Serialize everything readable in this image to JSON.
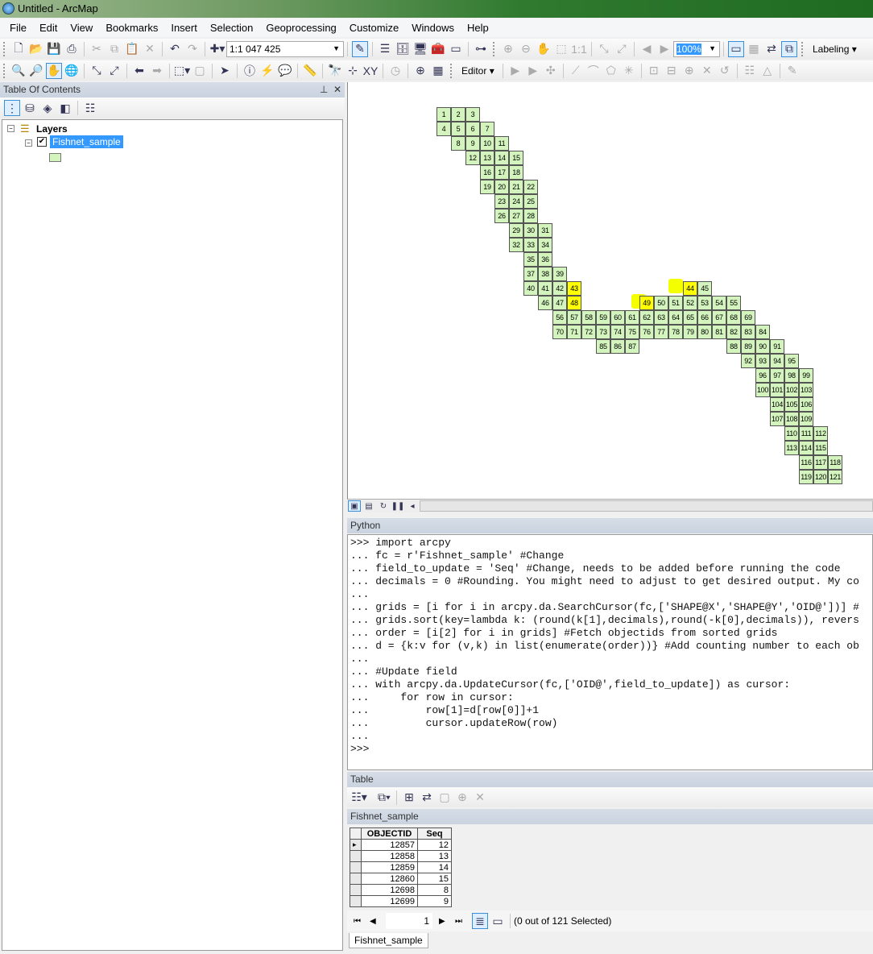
{
  "window": {
    "title": "Untitled - ArcMap"
  },
  "menu": [
    "File",
    "Edit",
    "View",
    "Bookmarks",
    "Insert",
    "Selection",
    "Geoprocessing",
    "Customize",
    "Windows",
    "Help"
  ],
  "toolbar": {
    "scale": "1:1 047 425",
    "zoom_percent": "100%",
    "labeling": "Labeling",
    "editor": "Editor"
  },
  "toc": {
    "title": "Table Of Contents",
    "root": "Layers",
    "layer": "Fishnet_sample",
    "layer_checked": true,
    "symbol_color": "#d3f5bd"
  },
  "map": {
    "cells": [
      "1",
      "2",
      "3",
      "4",
      "5",
      "6",
      "7",
      "8",
      "9",
      "10",
      "11",
      "12",
      "13",
      "14",
      "15",
      "16",
      "17",
      "18",
      "19",
      "20",
      "21",
      "22",
      "23",
      "24",
      "25",
      "26",
      "27",
      "28",
      "29",
      "30",
      "31",
      "32",
      "33",
      "34",
      "35",
      "36",
      "37",
      "38",
      "39",
      "40",
      "41",
      "42",
      "43",
      "44",
      "45",
      "46",
      "47",
      "48",
      "49",
      "50",
      "51",
      "52",
      "53",
      "54",
      "55",
      "56",
      "57",
      "58",
      "59",
      "60",
      "61",
      "62",
      "63",
      "64",
      "65",
      "66",
      "67",
      "68",
      "69",
      "70",
      "71",
      "72",
      "73",
      "74",
      "75",
      "76",
      "77",
      "78",
      "79",
      "80",
      "81",
      "82",
      "83",
      "84",
      "85",
      "86",
      "87",
      "88",
      "89",
      "90",
      "91",
      "92",
      "93",
      "94",
      "95",
      "96",
      "97",
      "98",
      "99",
      "100",
      "101",
      "102",
      "103",
      "104",
      "105",
      "106",
      "107",
      "108",
      "109",
      "110",
      "111",
      "112",
      "113",
      "114",
      "115",
      "116",
      "117",
      "118",
      "119",
      "120",
      "121"
    ],
    "highlighted": [
      "43",
      "44",
      "48",
      "49"
    ],
    "fill_color": "#d3f5bd",
    "highlight_color": "#ffff00"
  },
  "python": {
    "title": "Python",
    "lines": [
      ">>> import arcpy",
      "... fc = r'Fishnet_sample' #Change",
      "... field_to_update = 'Seq' #Change, needs to be added before running the code",
      "... decimals = 0 #Rounding. You might need to adjust to get desired output. My co",
      "...",
      "... grids = [i for i in arcpy.da.SearchCursor(fc,['SHAPE@X','SHAPE@Y','OID@'])] #",
      "... grids.sort(key=lambda k: (round(k[1],decimals),round(-k[0],decimals)), revers",
      "... order = [i[2] for i in grids] #Fetch objectids from sorted grids",
      "... d = {k:v for (v,k) in list(enumerate(order))} #Add counting number to each ob",
      "...",
      "... #Update field",
      "... with arcpy.da.UpdateCursor(fc,['OID@',field_to_update]) as cursor:",
      "...     for row in cursor:",
      "...         row[1]=d[row[0]]+1",
      "...         cursor.updateRow(row)",
      "...",
      ">>>"
    ]
  },
  "table": {
    "title": "Table",
    "layer": "Fishnet_sample",
    "columns": [
      "OBJECTID",
      "Seq"
    ],
    "rows": [
      [
        "12857",
        "12"
      ],
      [
        "12858",
        "13"
      ],
      [
        "12859",
        "14"
      ],
      [
        "12860",
        "15"
      ],
      [
        "12698",
        "8"
      ],
      [
        "12699",
        "9"
      ]
    ],
    "page": "1",
    "status": "(0 out of 121 Selected)",
    "tab": "Fishnet_sample"
  }
}
